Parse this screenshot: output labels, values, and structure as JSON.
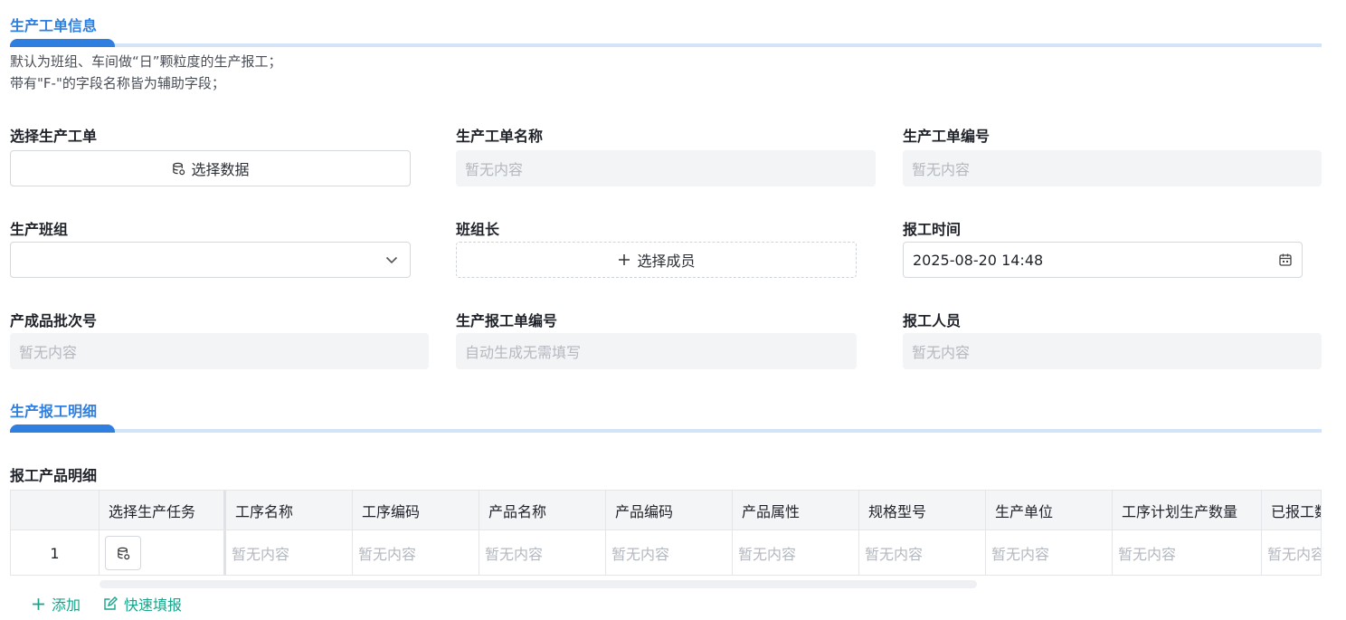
{
  "section1": {
    "title": "生产工单信息",
    "desc_line1": "默认为班组、车间做“日”颗粒度的生产报工；",
    "desc_line2": "带有\"F-\"的字段名称皆为辅助字段；"
  },
  "fields": {
    "select_order": {
      "label": "选择生产工单",
      "button": "选择数据"
    },
    "order_name": {
      "label": "生产工单名称",
      "placeholder": "暂无内容"
    },
    "order_no": {
      "label": "生产工单编号",
      "placeholder": "暂无内容"
    },
    "team": {
      "label": "生产班组",
      "value": ""
    },
    "team_leader": {
      "label": "班组长",
      "button": "选择成员"
    },
    "report_time": {
      "label": "报工时间",
      "value": "2025-08-20 14:48"
    },
    "batch_no": {
      "label": "产成品批次号",
      "placeholder": "暂无内容"
    },
    "report_no": {
      "label": "生产报工单编号",
      "placeholder": "自动生成无需填写"
    },
    "reporter": {
      "label": "报工人员",
      "placeholder": "暂无内容"
    }
  },
  "section2": {
    "title": "生产报工明细"
  },
  "detail": {
    "label": "报工产品明细",
    "columns": [
      "选择生产任务",
      "工序名称",
      "工序编码",
      "产品名称",
      "产品编码",
      "产品属性",
      "规格型号",
      "生产单位",
      "工序计划生产数量",
      "已报工数"
    ],
    "row": {
      "index": "1",
      "placeholder": "暂无内容"
    }
  },
  "actions": {
    "add": "添加",
    "quick_fill": "快速填报"
  },
  "colors": {
    "accent": "#2f7fe0",
    "action": "#1aa38a"
  }
}
